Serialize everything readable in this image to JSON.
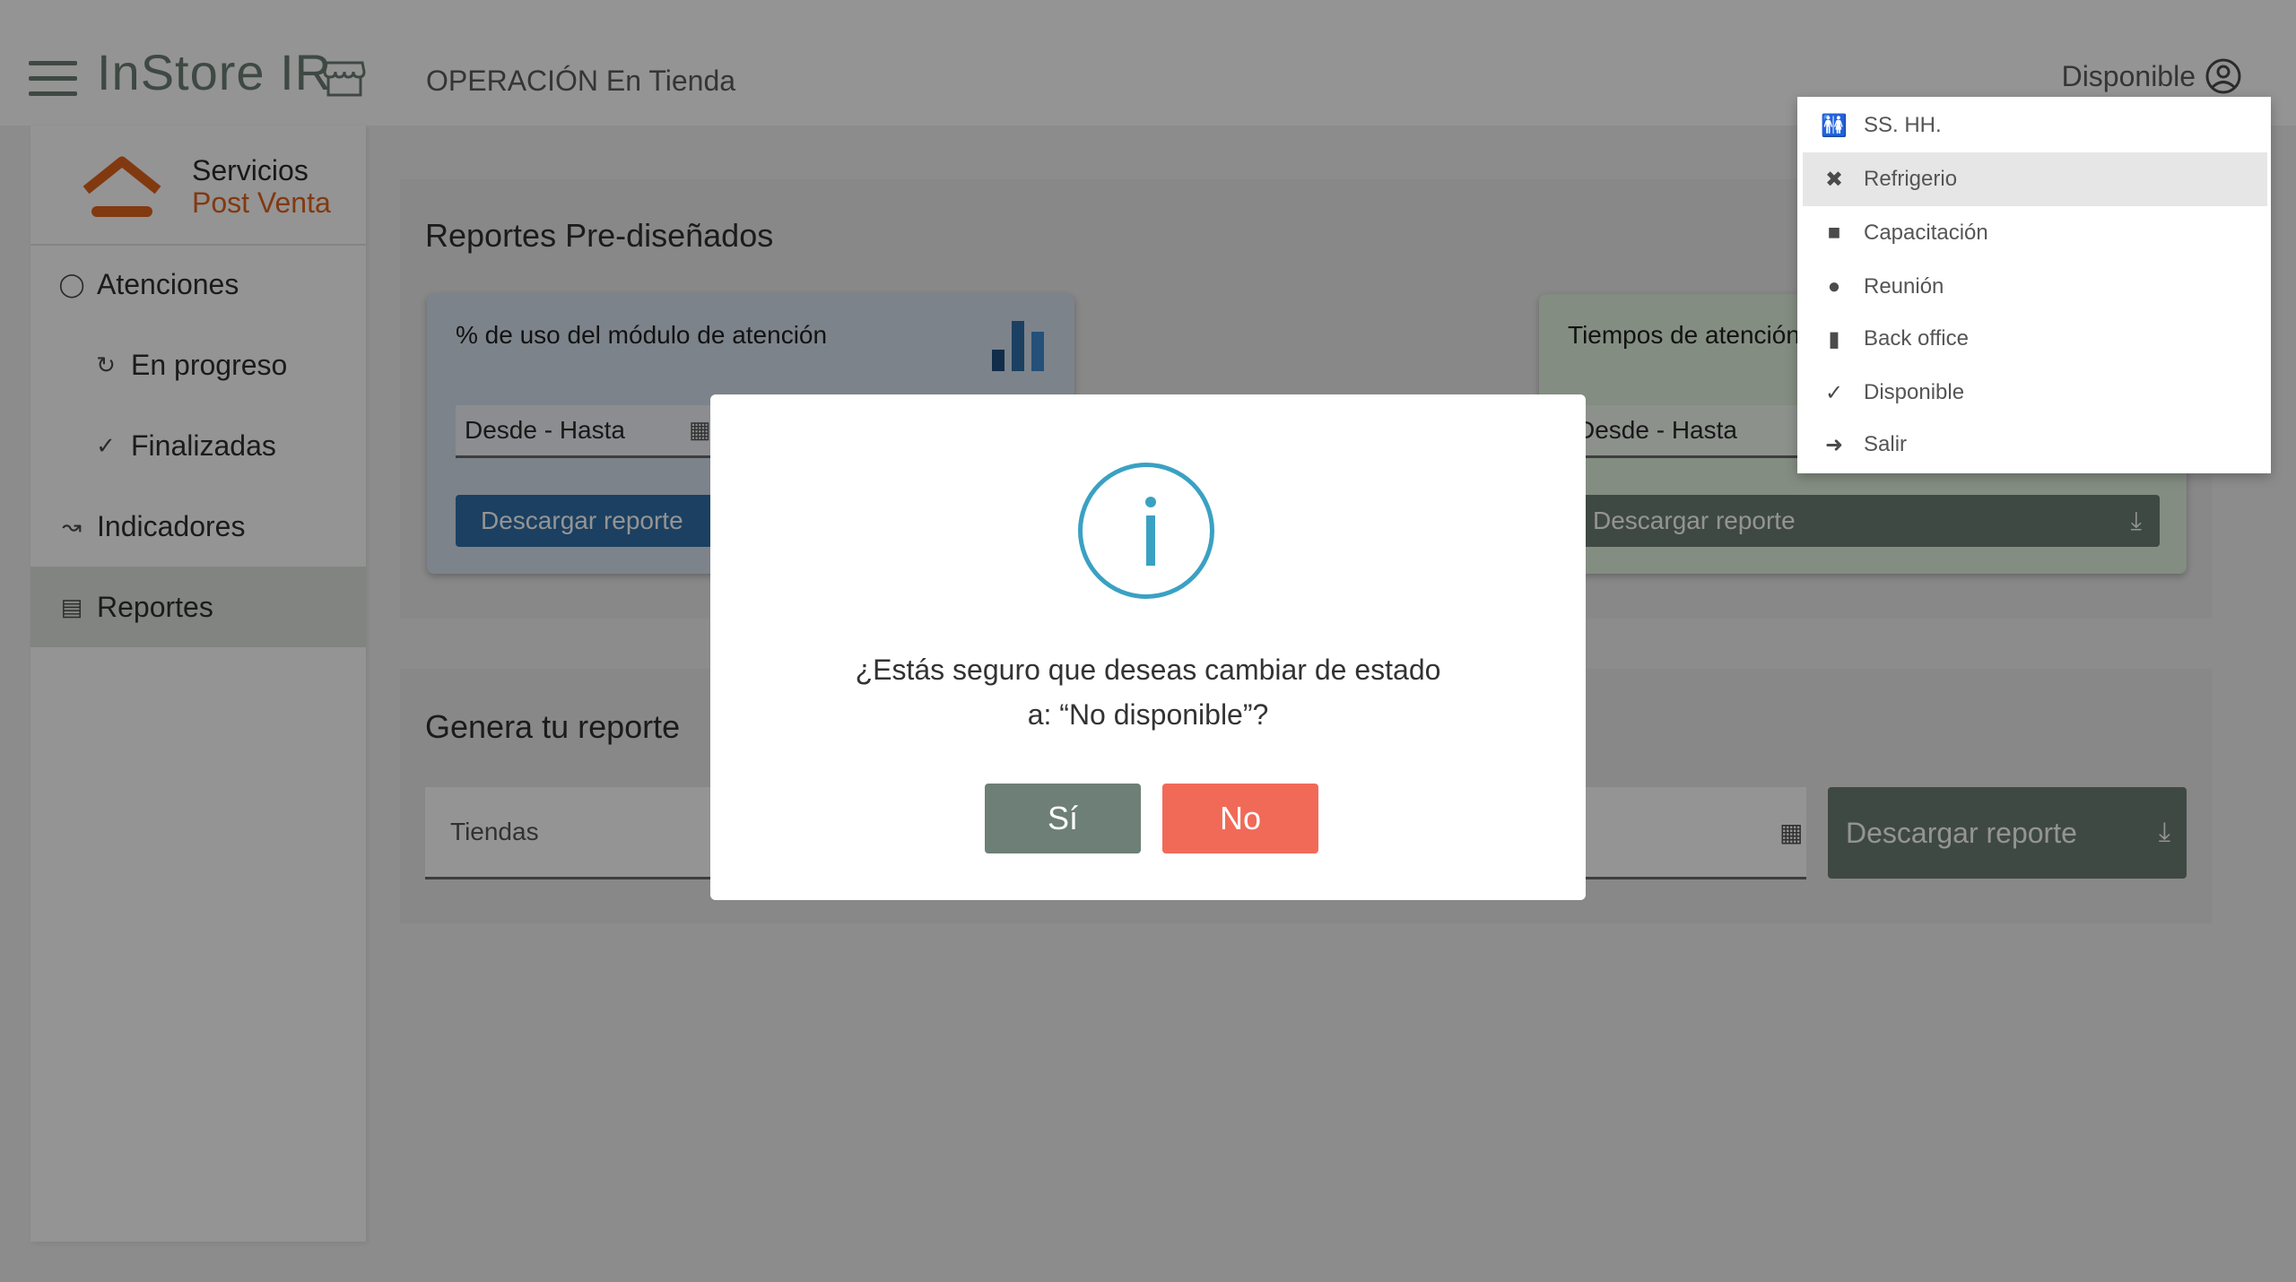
{
  "header": {
    "brand": "InStore IR",
    "page_title": "OPERACIÓN En Tienda",
    "status_label": "Disponible"
  },
  "sidebar": {
    "logo_line1": "Servicios",
    "logo_line2": "Post Venta",
    "items": [
      {
        "label": "Atenciones",
        "icon": "person-icon"
      },
      {
        "label": "En progreso",
        "icon": "sync-icon"
      },
      {
        "label": "Finalizadas",
        "icon": "check-icon"
      },
      {
        "label": "Indicadores",
        "icon": "trend-icon"
      },
      {
        "label": "Reportes",
        "icon": "report-icon"
      }
    ]
  },
  "predesigned": {
    "title": "Reportes Pre-diseñados",
    "card1": {
      "title": "% de uso del módulo de atención",
      "date_placeholder": "Desde - Hasta",
      "button": "Descargar reporte"
    },
    "card2": {
      "title": "Tiempos de atención",
      "date_placeholder": "Desde - Hasta",
      "button": "Descargar reporte"
    }
  },
  "custom": {
    "title": "Genera tu reporte",
    "stores_placeholder": "Tiendas",
    "button": "Descargar reporte"
  },
  "status_menu": {
    "items": [
      {
        "label": "SS. HH.",
        "icon": "restroom-icon"
      },
      {
        "label": "Refrigerio",
        "icon": "utensils-icon"
      },
      {
        "label": "Capacitación",
        "icon": "training-icon"
      },
      {
        "label": "Reunión",
        "icon": "group-icon"
      },
      {
        "label": "Back office",
        "icon": "folder-icon"
      },
      {
        "label": "Disponible",
        "icon": "check-icon"
      },
      {
        "label": "Salir",
        "icon": "exit-arrow-icon"
      }
    ]
  },
  "modal": {
    "line1": "¿Estás seguro que deseas cambiar de estado",
    "line2": "a: “No disponible”?",
    "yes_label": "Sí",
    "no_label": "No"
  },
  "colors": {
    "brand_green": "#6d7f76",
    "primary_blue": "#2f6fa8",
    "danger_red": "#f16a58",
    "info_cyan": "#3aa1c3",
    "logo_orange": "#e0621c"
  }
}
